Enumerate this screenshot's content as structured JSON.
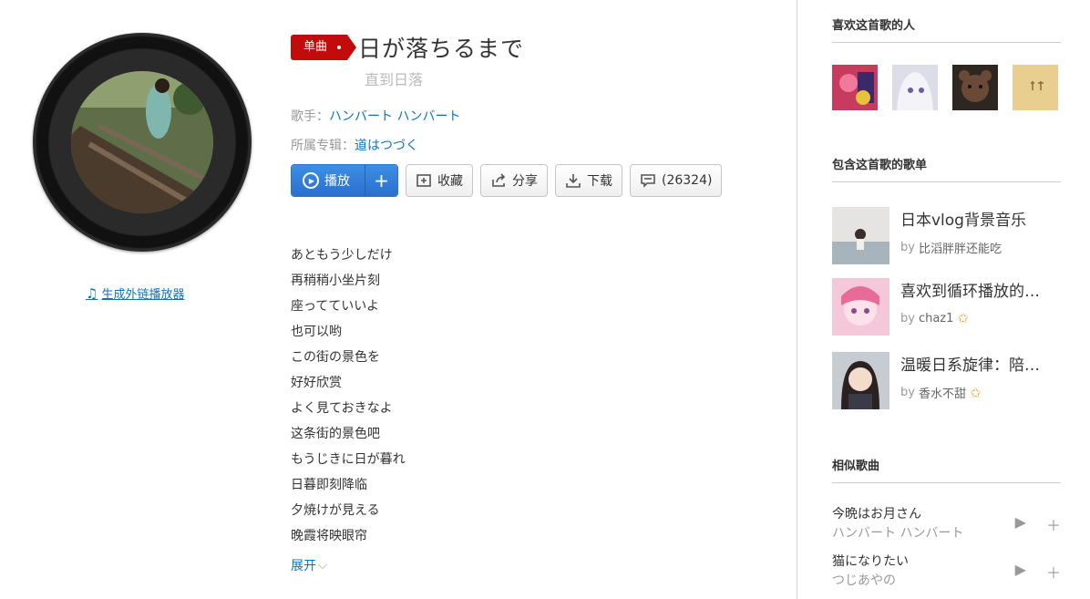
{
  "song": {
    "badge": "单曲",
    "title": "日が落ちるまで",
    "subtitle": "直到日落",
    "artist_label": "歌手：",
    "artist": "ハンバート ハンバート",
    "album_label": "所属专辑：",
    "album": "道はつづく"
  },
  "actions": {
    "play": "播放",
    "add": "+",
    "collect": "收藏",
    "share": "分享",
    "download": "下载",
    "comments": "(26324)"
  },
  "left": {
    "generate_player": "生成外链播放器"
  },
  "lyrics": [
    "あともう少しだけ",
    "再稍稍小坐片刻",
    "座ってていいよ",
    "也可以哟",
    "この街の景色を",
    "好好欣赏",
    "よく見ておきなよ",
    "这条街的景色吧",
    "もうじきに日が暮れ",
    "日暮即刻降临",
    "夕焼けが見える",
    "晚霞将映眼帘"
  ],
  "expand": "展开",
  "sidebar": {
    "likers_title": "喜欢这首歌的人",
    "playlists_title": "包含这首歌的歌单",
    "playlists": [
      {
        "name": "日本vlog背景音乐",
        "by": "by",
        "user": "比滔胖胖还能吃",
        "star": false
      },
      {
        "name": "喜欢到循环播放的日系",
        "by": "by",
        "user": "chaz1",
        "star": true
      },
      {
        "name": "温暖日系旋律：陪你入眠",
        "by": "by",
        "user": "香水不甜",
        "star": true
      }
    ],
    "similar_title": "相似歌曲",
    "similar": [
      {
        "name": "今晩はお月さん",
        "artist": "ハンバート ハンバート"
      },
      {
        "name": "猫になりたい",
        "artist": "つじあやの"
      }
    ]
  },
  "colors": {
    "accent_red": "#c20c0c",
    "link_blue": "#0c73c2",
    "play_blue": "#2a6fce"
  }
}
